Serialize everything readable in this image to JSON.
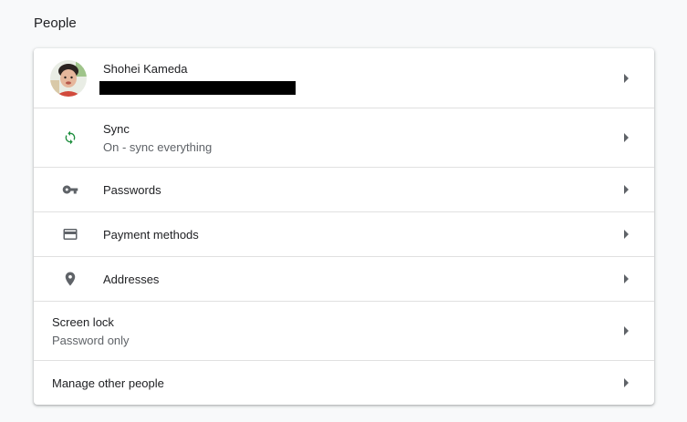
{
  "section": {
    "title": "People"
  },
  "profile": {
    "name": "Shohei Kameda",
    "avatar_icon": "profile-avatar"
  },
  "sync": {
    "label": "Sync",
    "status": "On - sync everything",
    "icon": "sync-icon",
    "icon_color": "#1e8e3e"
  },
  "passwords": {
    "label": "Passwords",
    "icon": "key-icon"
  },
  "payment": {
    "label": "Payment methods",
    "icon": "credit-card-icon"
  },
  "addresses": {
    "label": "Addresses",
    "icon": "location-pin-icon"
  },
  "screen_lock": {
    "label": "Screen lock",
    "status": "Password only"
  },
  "manage_people": {
    "label": "Manage other people"
  },
  "colors": {
    "background": "#f8f9fa",
    "card": "#ffffff",
    "divider": "#e0e0e0",
    "secondary_text": "#5f6368",
    "icon_gray": "#5f6368"
  }
}
